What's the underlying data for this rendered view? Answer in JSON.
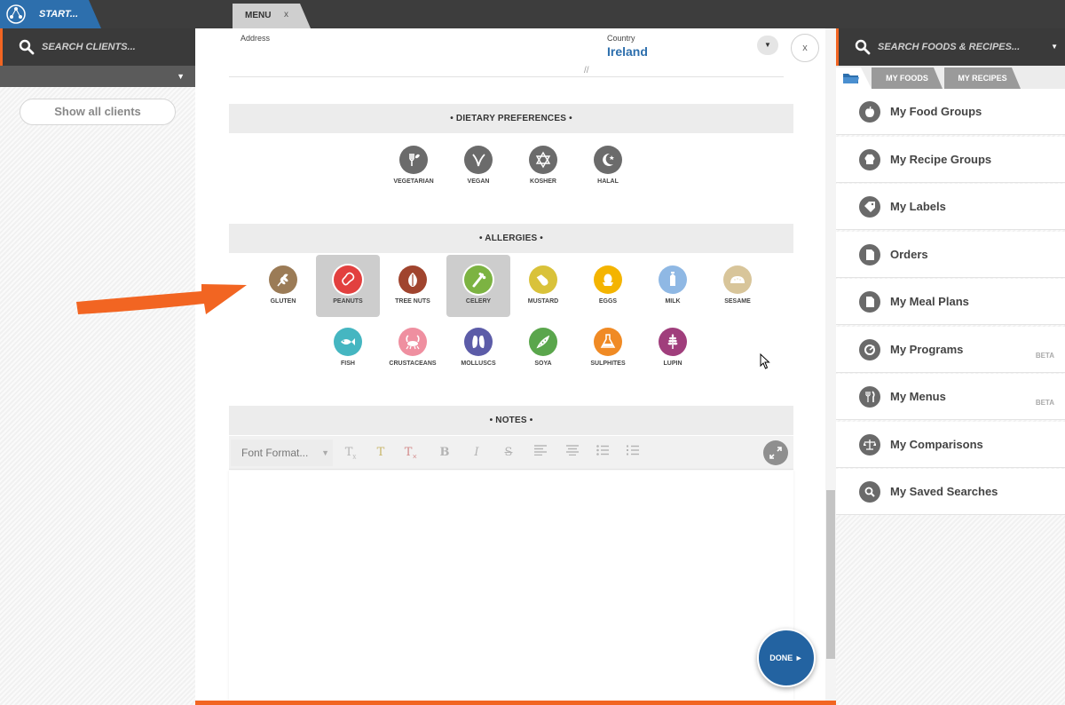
{
  "topbar": {
    "start_label": "START...",
    "menu_tab_label": "MENU",
    "menu_tab_close": "x"
  },
  "left": {
    "search_placeholder": "SEARCH CLIENTS...",
    "filter_arrow": "▼",
    "show_all": "Show all clients"
  },
  "form": {
    "address_label": "Address",
    "country_label": "Country",
    "country_value": "Ireland",
    "country_dropdown": "▼",
    "resize_grip": "//",
    "close": "x"
  },
  "dietary": {
    "header": "• DIETARY PREFERENCES •",
    "items": [
      {
        "label": "VEGETARIAN",
        "color": "#6b6b6b",
        "icon": "vegetarian-icon"
      },
      {
        "label": "VEGAN",
        "color": "#6b6b6b",
        "icon": "vegan-icon"
      },
      {
        "label": "KOSHER",
        "color": "#6b6b6b",
        "icon": "kosher-icon"
      },
      {
        "label": "HALAL",
        "color": "#6b6b6b",
        "icon": "halal-icon"
      }
    ]
  },
  "allergies": {
    "header": "• ALLERGIES •",
    "items": [
      {
        "label": "GLUTEN",
        "color": "#9b7b56",
        "icon": "wheat-icon",
        "selected": false
      },
      {
        "label": "PEANUTS",
        "color": "#e2403f",
        "icon": "peanut-icon",
        "selected": true
      },
      {
        "label": "TREE NUTS",
        "color": "#a0442e",
        "icon": "tree-nut-icon",
        "selected": false
      },
      {
        "label": "CELERY",
        "color": "#7cb342",
        "icon": "celery-icon",
        "selected": true
      },
      {
        "label": "MUSTARD",
        "color": "#d9c23a",
        "icon": "mustard-icon",
        "selected": false
      },
      {
        "label": "EGGS",
        "color": "#f4b400",
        "icon": "egg-icon",
        "selected": false
      },
      {
        "label": "MILK",
        "color": "#8fb8e4",
        "icon": "milk-icon",
        "selected": false
      },
      {
        "label": "SESAME",
        "color": "#d8c59a",
        "icon": "sesame-icon",
        "selected": false
      },
      {
        "label": "FISH",
        "color": "#45b6c1",
        "icon": "fish-icon",
        "selected": false
      },
      {
        "label": "CRUSTACEANS",
        "color": "#ef8fa0",
        "icon": "crustacean-icon",
        "selected": false
      },
      {
        "label": "MOLLUSCS",
        "color": "#5c5ca8",
        "icon": "mollusc-icon",
        "selected": false
      },
      {
        "label": "SOYA",
        "color": "#5aa64c",
        "icon": "soya-icon",
        "selected": false
      },
      {
        "label": "SULPHITES",
        "color": "#f08a24",
        "icon": "sulphite-icon",
        "selected": false
      },
      {
        "label": "LUPIN",
        "color": "#a03e7c",
        "icon": "lupin-icon",
        "selected": false
      }
    ]
  },
  "notes": {
    "header": "• NOTES •",
    "font_format": "Font Format...",
    "font_format_arrow": "▼"
  },
  "done": "DONE ►",
  "right": {
    "search_placeholder": "SEARCH FOODS & RECIPES...",
    "search_arrow": "▼",
    "tabs": [
      "MY FOODS",
      "MY RECIPES"
    ],
    "items": [
      {
        "label": "My Food Groups",
        "icon": "apple-icon",
        "badge": ""
      },
      {
        "label": "My Recipe Groups",
        "icon": "chef-hat-icon",
        "badge": ""
      },
      {
        "label": "My Labels",
        "icon": "tag-icon",
        "badge": ""
      },
      {
        "label": "Orders",
        "icon": "document-icon",
        "badge": ""
      },
      {
        "label": "My Meal Plans",
        "icon": "meal-plan-icon",
        "badge": ""
      },
      {
        "label": "My Programs",
        "icon": "program-icon",
        "badge": "BETA"
      },
      {
        "label": "My Menus",
        "icon": "cutlery-icon",
        "badge": "BETA"
      },
      {
        "label": "My Comparisons",
        "icon": "scales-icon",
        "badge": ""
      },
      {
        "label": "My Saved Searches",
        "icon": "saved-search-icon",
        "badge": ""
      }
    ]
  }
}
